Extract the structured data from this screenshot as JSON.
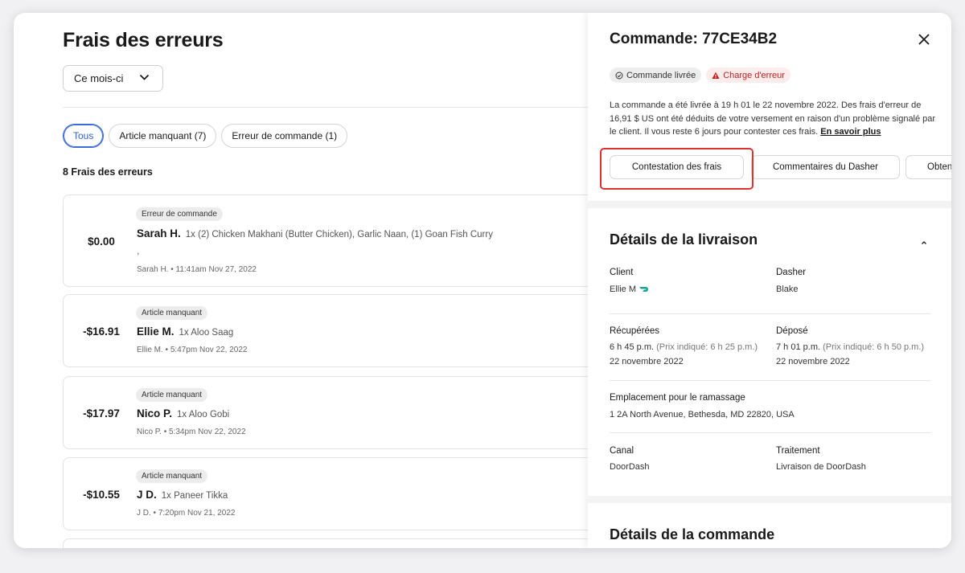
{
  "left": {
    "title": "Frais des erreurs",
    "period": "Ce mois-ci",
    "filters": [
      "Tous",
      "Article manquant (7)",
      "Erreur de commande (1)"
    ],
    "count_label": "8 Frais des erreurs",
    "entries": [
      {
        "amount": "$0.00",
        "tag": "Erreur de commande",
        "name": "Sarah H.",
        "items": "1x (2) Chicken Makhani (Butter Chicken), Garlic Naan, (1) Goan Fish Curry",
        "extra": ",",
        "meta": "Sarah H. • 11:41am Nov 27, 2022"
      },
      {
        "amount": "-$16.91",
        "tag": "Article manquant",
        "name": "Ellie M.",
        "items": "1x Aloo Saag",
        "meta": "Ellie M. • 5:47pm Nov 22, 2022"
      },
      {
        "amount": "-$17.97",
        "tag": "Article manquant",
        "name": "Nico P.",
        "items": "1x Aloo Gobi",
        "meta": "Nico P. • 5:34pm Nov 22, 2022"
      },
      {
        "amount": "-$10.55",
        "tag": "Article manquant",
        "name": "J D.",
        "items": "1x Paneer Tikka",
        "meta": "J D. • 7:20pm Nov 21, 2022"
      }
    ]
  },
  "panel": {
    "title": "Commande: 77CE34B2",
    "badge_delivered": "Commande livrée",
    "badge_error": "Charge d'erreur",
    "description": "La commande a été livrée à 19 h 01 le 22 novembre 2022. Des frais d'erreur de 16,91 $ US ont été déduits de votre versement en raison d'un problème signalé par le client. Il vous reste 6 jours pour contester ces frais. ",
    "learn_more": "En savoir plus",
    "buttons": [
      "Contestation des frais",
      "Commentaires du Dasher",
      "Obtenir"
    ],
    "delivery_title": "Détails de la livraison",
    "client_label": "Client",
    "client_value": "Ellie M",
    "dasher_label": "Dasher",
    "dasher_value": "Blake",
    "pickup_label": "Récupérées",
    "pickup_time": "6 h 45 p.m.",
    "pickup_quoted": "(Prix indiqué: 6 h 25 p.m.)",
    "pickup_date": "22 novembre 2022",
    "dropoff_label": "Déposé",
    "dropoff_time": "7 h 01 p.m.",
    "dropoff_quoted": "(Prix indiqué: 6 h 50 p.m.)",
    "dropoff_date": "22 novembre 2022",
    "location_label": "Emplacement pour le ramassage",
    "location_value": "1 2A North Avenue, Bethesda, MD 22820, USA",
    "channel_label": "Canal",
    "channel_value": "DoorDash",
    "fulfillment_label": "Traitement",
    "fulfillment_value": "Livraison de DoorDash",
    "order_details_title": "Détails de la commande"
  },
  "colors": {
    "accent": "#3a6cd6",
    "error": "#c21f1f",
    "highlight": "#e23030",
    "dasher_green": "#12a594"
  }
}
